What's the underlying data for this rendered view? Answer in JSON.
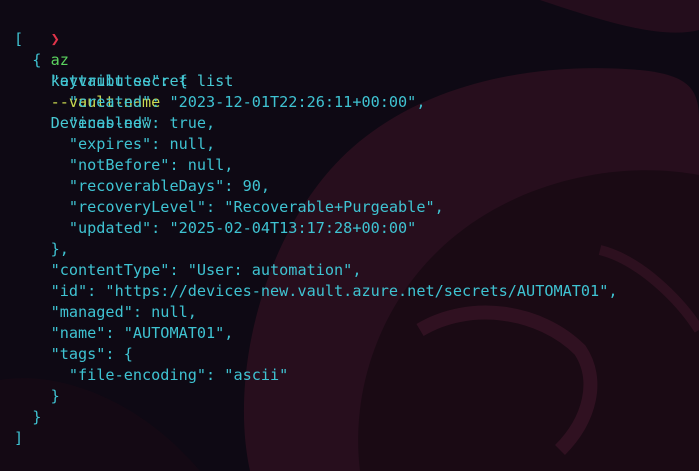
{
  "colors": {
    "background": "#0e0914",
    "prompt": "#e0344a",
    "command": "#5bd35f",
    "text": "#48c9d4",
    "flag": "#c9d84f",
    "json": "#3fc3d2"
  },
  "prompt": {
    "glyph": "❯",
    "command": "az",
    "args1": "keyvault secret list",
    "flag": "--vault-name",
    "value": "Devices-new"
  },
  "output": [
    "[",
    "  {",
    "    \"attributes\": {",
    "      \"created\": \"2023-12-01T22:26:11+00:00\",",
    "      \"enabled\": true,",
    "      \"expires\": null,",
    "      \"notBefore\": null,",
    "      \"recoverableDays\": 90,",
    "      \"recoveryLevel\": \"Recoverable+Purgeable\",",
    "      \"updated\": \"2025-02-04T13:17:28+00:00\"",
    "    },",
    "    \"contentType\": \"User: automation\",",
    "    \"id\": \"https://devices-new.vault.azure.net/secrets/AUTOMAT01\",",
    "    \"managed\": null,",
    "    \"name\": \"AUTOMAT01\",",
    "    \"tags\": {",
    "      \"file-encoding\": \"ascii\"",
    "    }",
    "  }",
    "]"
  ]
}
